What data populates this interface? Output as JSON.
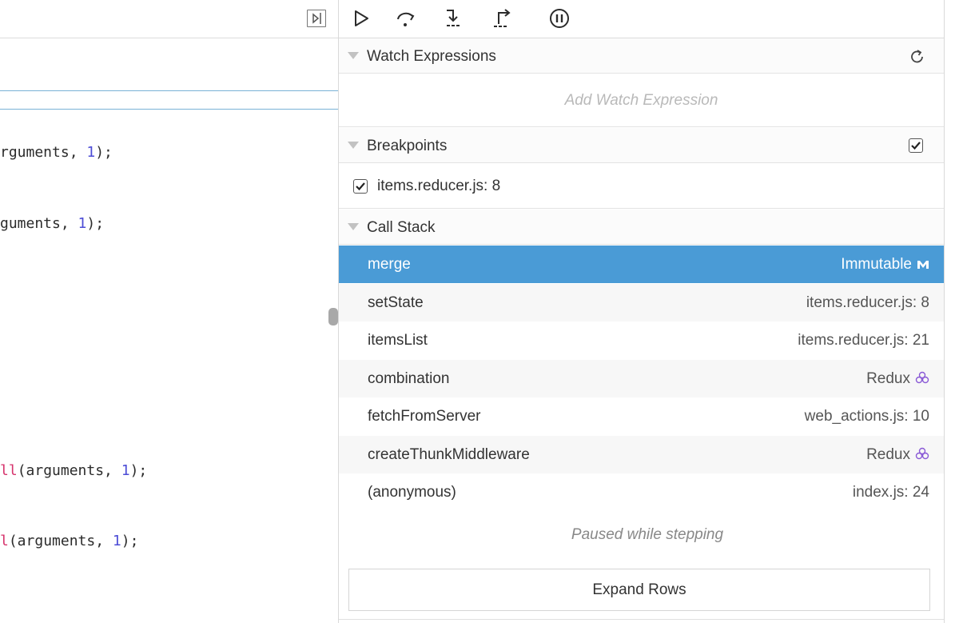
{
  "editor": {
    "code_lines": [
      {
        "pre": "rguments, ",
        "num": "1",
        "post": ");"
      },
      {
        "pre": "guments, ",
        "num": "1",
        "post": ");"
      },
      {
        "fn": "ll",
        "pre": "(arguments, ",
        "num": "1",
        "post": ");"
      },
      {
        "fn": "l",
        "pre": "(arguments, ",
        "num": "1",
        "post": ");"
      }
    ]
  },
  "toolbar": {
    "buttons": [
      "resume-icon",
      "step-over-icon",
      "step-in-icon",
      "step-out-icon",
      "pause-on-exceptions-icon"
    ]
  },
  "watch": {
    "title": "Watch Expressions",
    "placeholder": "Add Watch Expression"
  },
  "breakpoints": {
    "title": "Breakpoints",
    "items": [
      {
        "label": "items.reducer.js: 8",
        "checked": true
      }
    ]
  },
  "callstack": {
    "title": "Call Stack",
    "frames": [
      {
        "name": "merge",
        "location": "Immutable",
        "selected": true,
        "library_icon": "immutable-icon"
      },
      {
        "name": "setState",
        "location": "items.reducer.js: 8"
      },
      {
        "name": "itemsList",
        "location": "items.reducer.js: 21"
      },
      {
        "name": "combination",
        "location": "Redux",
        "library_icon": "redux-icon"
      },
      {
        "name": "fetchFromServer",
        "location": "web_actions.js: 10"
      },
      {
        "name": "createThunkMiddleware",
        "location": "Redux",
        "library_icon": "redux-icon"
      },
      {
        "name": "(anonymous)",
        "location": "index.js: 24"
      }
    ],
    "paused_message": "Paused while stepping",
    "expand_label": "Expand Rows"
  },
  "colors": {
    "selected_row": "#4a9bd6",
    "redux_purple": "#8a5ad6",
    "number_blue": "#4d4dd6",
    "fn_pink": "#d6336c"
  }
}
